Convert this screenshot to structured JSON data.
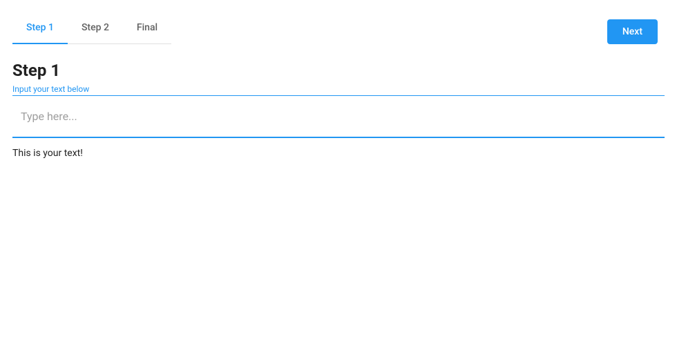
{
  "colors": {
    "primary": "#2196f3"
  },
  "tabs": [
    {
      "label": "Step 1",
      "active": true
    },
    {
      "label": "Step 2",
      "active": false
    },
    {
      "label": "Final",
      "active": false
    }
  ],
  "nextButton": {
    "label": "Next"
  },
  "step": {
    "heading": "Step 1",
    "fieldLabel": "Input your text below",
    "placeholder": "Type here...",
    "value": ""
  },
  "resultText": "This is your text!"
}
